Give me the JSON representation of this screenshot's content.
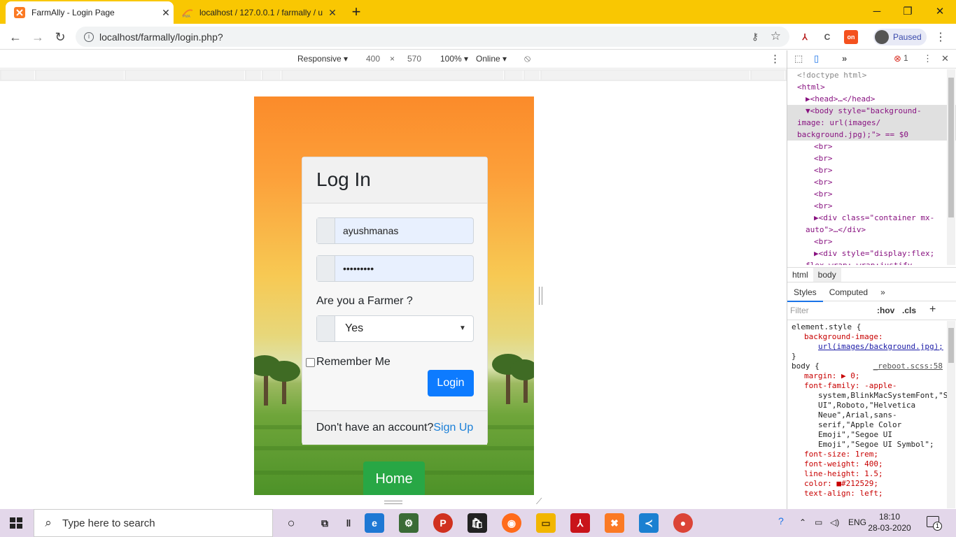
{
  "tabs": [
    {
      "title": "FarmAlly - Login Page",
      "active": true
    },
    {
      "title": "localhost / 127.0.0.1 / farmally / u",
      "active": false
    }
  ],
  "window_controls": {
    "minimize": "─",
    "maximize": "❐",
    "close": "✕"
  },
  "toolbar": {
    "url": "localhost/farmally/login.php?",
    "profile_status": "Paused"
  },
  "device_toolbar": {
    "mode": "Responsive",
    "width": "400",
    "x": "×",
    "height": "570",
    "zoom": "100%",
    "network": "Online"
  },
  "login_page": {
    "card_title": "Log In",
    "username": "ayushmanas",
    "password_mask": "•••••••••",
    "farmer_question": "Are you a Farmer ?",
    "farmer_selected": "Yes",
    "remember_label": "Remember Me",
    "login_button": "Login",
    "no_account_text": "Don't have an account?",
    "signup_link": "Sign Up",
    "home_button": "Home"
  },
  "devtools": {
    "error_count": "1",
    "elements": [
      {
        "text": "<!doctype html>",
        "kind": "comment",
        "indent": 0
      },
      {
        "text": "<html>",
        "kind": "tag",
        "indent": 0
      },
      {
        "text": "▶<head>…</head>",
        "kind": "tag",
        "indent": 1
      },
      {
        "text": "▼<body style=\"background-",
        "kind": "selected",
        "indent": 1
      },
      {
        "text": "image: url(images/",
        "kind": "selected",
        "indent": 0
      },
      {
        "text": "background.jpg);\"> == $0",
        "kind": "selected",
        "indent": 0
      },
      {
        "text": "<br>",
        "kind": "tag",
        "indent": 2
      },
      {
        "text": "<br>",
        "kind": "tag",
        "indent": 2
      },
      {
        "text": "<br>",
        "kind": "tag",
        "indent": 2
      },
      {
        "text": "<br>",
        "kind": "tag",
        "indent": 2
      },
      {
        "text": "<br>",
        "kind": "tag",
        "indent": 2
      },
      {
        "text": "<br>",
        "kind": "tag",
        "indent": 2
      },
      {
        "text": "▶<div class=\"container mx-",
        "kind": "tag",
        "indent": 2
      },
      {
        "text": "auto\">…</div>",
        "kind": "tag",
        "indent": 1
      },
      {
        "text": "<br>",
        "kind": "tag",
        "indent": 2
      },
      {
        "text": "▶<div style=\"display:flex;",
        "kind": "tag",
        "indent": 2
      },
      {
        "text": "flex-wrap: wrap;justify-",
        "kind": "tag",
        "indent": 1
      }
    ],
    "breadcrumbs": [
      "html",
      "body"
    ],
    "panel_tabs": [
      "Styles",
      "Computed",
      "»"
    ],
    "filter_placeholder": "Filter",
    "hov": ":hov",
    "cls": ".cls",
    "styles": [
      {
        "text": "element.style {",
        "kind": "selector"
      },
      {
        "text": "background-image:",
        "kind": "prop"
      },
      {
        "text": "url(images/background.jpg);",
        "kind": "link"
      },
      {
        "text": "}",
        "kind": "selector"
      },
      {
        "text": "body {",
        "kind": "selector",
        "source": "_reboot.scss:58"
      },
      {
        "text": "margin: ▶ 0;",
        "kind": "prop"
      },
      {
        "text": "font-family: -apple-",
        "kind": "prop"
      },
      {
        "text": "system,BlinkMacSystemFont,\"S",
        "kind": "value"
      },
      {
        "text": "UI\",Roboto,\"Helvetica",
        "kind": "value"
      },
      {
        "text": "Neue\",Arial,sans-",
        "kind": "value"
      },
      {
        "text": "serif,\"Apple Color",
        "kind": "value"
      },
      {
        "text": "Emoji\",\"Segoe UI",
        "kind": "value"
      },
      {
        "text": "Emoji\",\"Segoe UI Symbol\";",
        "kind": "value"
      },
      {
        "text": "font-size: 1rem;",
        "kind": "prop"
      },
      {
        "text": "font-weight: 400;",
        "kind": "prop"
      },
      {
        "text": "line-height: 1.5;",
        "kind": "prop"
      },
      {
        "text": "color: ■#212529;",
        "kind": "prop"
      },
      {
        "text": "text-align: left;",
        "kind": "prop"
      }
    ]
  },
  "taskbar": {
    "search_placeholder": "Type here to search",
    "language": "ENG",
    "time": "18:10",
    "date": "28-03-2020",
    "notification_count": "1"
  },
  "colors": {
    "chrome_frame": "#f9c702",
    "login_button": "#0d7bff",
    "home_button": "#28a745",
    "link": "#1a7fd8"
  }
}
